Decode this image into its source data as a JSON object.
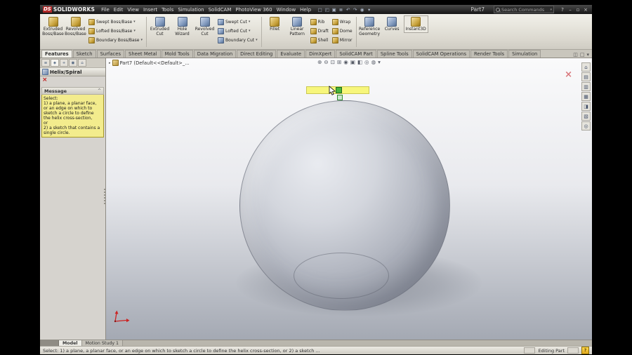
{
  "glyphs": {
    "dropdown": "▾",
    "expand": "▸",
    "collapse": "^",
    "close": "×",
    "minimize": "–",
    "maximize": "▫",
    "help": "?"
  },
  "titlebar": {
    "logo_ds": "DS",
    "logo_name": "SOLIDWORKS",
    "menus": [
      "File",
      "Edit",
      "View",
      "Insert",
      "Tools",
      "Simulation",
      "SolidCAM",
      "PhotoView 360",
      "Window",
      "Help"
    ],
    "quick_icons": [
      {
        "name": "new-icon",
        "glyph": "□"
      },
      {
        "name": "open-icon",
        "glyph": "◰"
      },
      {
        "name": "save-icon",
        "glyph": "▣"
      },
      {
        "name": "print-icon",
        "glyph": "≣"
      },
      {
        "name": "undo-icon",
        "glyph": "↶"
      },
      {
        "name": "redo-icon",
        "glyph": "↷"
      },
      {
        "name": "rebuild-icon",
        "glyph": "◉"
      },
      {
        "name": "options-icon",
        "glyph": "▾"
      }
    ],
    "title": "Part7",
    "search_placeholder": "Search Commands"
  },
  "ribbon": {
    "large": [
      {
        "label": "Extruded Boss/Base"
      },
      {
        "label": "Revolved Boss/Base"
      },
      {
        "label": "Extruded Cut"
      },
      {
        "label": "Hole Wizard"
      },
      {
        "label": "Revolved Cut"
      },
      {
        "label": "Fillet"
      },
      {
        "label": "Linear Pattern"
      },
      {
        "label": "Reference Geometry"
      },
      {
        "label": "Curves"
      },
      {
        "label": "Instant3D"
      }
    ],
    "stacks": [
      [
        "Swept Boss/Base",
        "Lofted Boss/Base",
        "Boundary Boss/Base"
      ],
      [
        "Swept Cut",
        "Lofted Cut",
        "Boundary Cut"
      ],
      [
        "Rib",
        "Draft",
        "Shell"
      ],
      [
        "Wrap",
        "Dome",
        "Mirror"
      ]
    ],
    "tabs": [
      {
        "label": "Features",
        "active": true
      },
      {
        "label": "Sketch"
      },
      {
        "label": "Surfaces"
      },
      {
        "label": "Sheet Metal"
      },
      {
        "label": "Mold Tools"
      },
      {
        "label": "Data Migration"
      },
      {
        "label": "Direct Editing"
      },
      {
        "label": "Evaluate"
      },
      {
        "label": "DimXpert"
      },
      {
        "label": "SolidCAM Part"
      },
      {
        "label": "Spline Tools"
      },
      {
        "label": "SolidCAM Operations"
      },
      {
        "label": "Render Tools"
      },
      {
        "label": "Simulation"
      }
    ],
    "pane_icons": [
      {
        "name": "viewport-split-icon",
        "glyph": "◫"
      },
      {
        "name": "pane-toggle-icon",
        "glyph": "□"
      },
      {
        "name": "pane-menu-icon",
        "glyph": "▾"
      }
    ]
  },
  "property_manager": {
    "tab_icons": [
      {
        "name": "featuremanager-tree-icon",
        "glyph": "≡"
      },
      {
        "name": "propertymanager-icon",
        "glyph": "◈",
        "active": true
      },
      {
        "name": "configurationmanager-icon",
        "glyph": "+"
      },
      {
        "name": "dimxpertmanager-icon",
        "glyph": "◉"
      },
      {
        "name": "displaymanager-icon",
        "glyph": "⌂"
      }
    ],
    "title": "Helix/Spiral",
    "message_header": "Message",
    "message_lines": [
      "Select:",
      "1) a plane, a planar face, or an edge on which to sketch a circle to define the helix cross-section,",
      "or",
      "2) a sketch that contains a single circle."
    ]
  },
  "viewport": {
    "tree_label": "Part7  (Default<<Default>_...",
    "toolbar": [
      {
        "name": "zoom-fit-icon",
        "glyph": "⊕"
      },
      {
        "name": "zoom-area-icon",
        "glyph": "⊖"
      },
      {
        "name": "zoom-in-out-icon",
        "glyph": "⊡"
      },
      {
        "name": "rotate-view-icon",
        "glyph": "⊞"
      },
      {
        "name": "pan-icon",
        "glyph": "◉"
      },
      {
        "name": "view-orientation-icon",
        "glyph": "▣"
      },
      {
        "name": "display-style-icon",
        "glyph": "◧"
      },
      {
        "name": "hide-show-items-icon",
        "glyph": "◎"
      },
      {
        "name": "edit-appearance-icon",
        "glyph": "◍"
      },
      {
        "name": "view-settings-arrow-icon",
        "glyph": "▾"
      }
    ],
    "task_pane_icons": [
      {
        "name": "solidworks-resources-icon",
        "glyph": "⌂"
      },
      {
        "name": "design-library-icon",
        "glyph": "▤"
      },
      {
        "name": "file-explorer-icon",
        "glyph": "▥"
      },
      {
        "name": "view-palette-icon",
        "glyph": "▦"
      },
      {
        "name": "appearances-scenes-icon",
        "glyph": "◨"
      },
      {
        "name": "custom-properties-icon",
        "glyph": "▧"
      },
      {
        "name": "document-recovery-icon",
        "glyph": "◎"
      }
    ]
  },
  "bottom": {
    "tabs": [
      {
        "label": "Model",
        "active": true
      },
      {
        "label": "Motion Study 1"
      }
    ],
    "status_left": "Select: 1) a plane, a planar face, or an edge on which to sketch a circle to define the helix cross-section, or 2) a sketch ...",
    "status_right": "Editing Part"
  }
}
